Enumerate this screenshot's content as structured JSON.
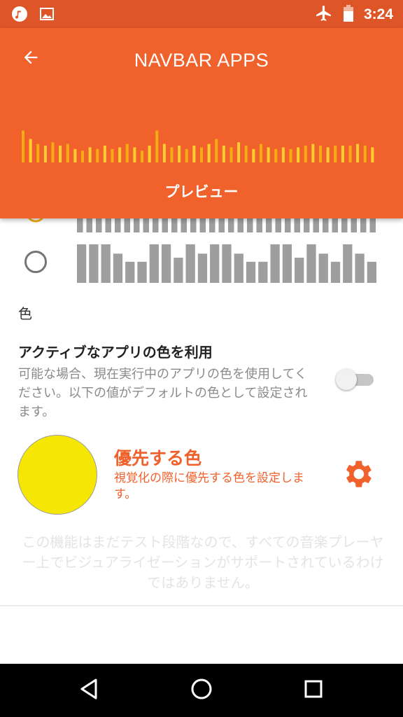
{
  "status_bar": {
    "time": "3:24",
    "left_icons": [
      "music-icon",
      "image-icon"
    ],
    "right_icons": [
      "airplane-icon",
      "battery-icon"
    ]
  },
  "app_bar": {
    "title": "NAVBAR APPS",
    "back_icon": "arrow-back-icon",
    "preview_label": "プレビュー",
    "preview_bar_heights": [
      0.95,
      0.7,
      0.55,
      0.5,
      0.6,
      0.5,
      0.55,
      0.4,
      0.35,
      0.45,
      0.4,
      0.5,
      0.4,
      0.45,
      0.55,
      0.45,
      0.35,
      0.5,
      0.95,
      0.55,
      0.45,
      0.5,
      0.4,
      0.5,
      0.45,
      0.55,
      0.7,
      0.5,
      0.45,
      0.6,
      0.5,
      0.4,
      0.55,
      0.45,
      0.4,
      0.45,
      0.4,
      0.45,
      0.5,
      0.55,
      0.5,
      0.45,
      0.5,
      0.5,
      0.5,
      0.55,
      0.5,
      0.45
    ],
    "colors": {
      "background": "#f0612c",
      "status_bar": "#de5527",
      "bar_primary": "#f5ac12",
      "bar_secondary": "#ffce2e"
    }
  },
  "styles": {
    "partial_option_bar_count": 32,
    "option_bar_heights": [
      0.95,
      0.95,
      0.95,
      0.72,
      0.52,
      0.52,
      0.95,
      0.95,
      0.62,
      0.95,
      0.72,
      0.95,
      0.95,
      0.72,
      0.52,
      0.52,
      0.95,
      0.95,
      0.62,
      0.95,
      0.72,
      0.52,
      0.95,
      0.72,
      0.52
    ],
    "bar_color": "#9e9e9e"
  },
  "color_section": {
    "header": "色",
    "use_app_color": {
      "title": "アクティブなアプリの色を利用",
      "summary": "可能な場合、現在実行中のアプリの色を使用してください。以下の値がデフォルトの色として設定されます。",
      "enabled": false
    },
    "preferred_color": {
      "title": "優先する色",
      "summary": "視覚化の際に優先する色を設定します。",
      "swatch": "#f5e603",
      "accent": "#f0612c",
      "settings_icon": "gear-icon"
    },
    "note": "この機能はまだテスト段階なので、すべての音楽プレーヤー上でビジュアライゼーションがサポートされているわけではありません。"
  },
  "nav_bar": {
    "buttons": [
      "back-triangle-icon",
      "home-circle-icon",
      "recents-square-icon"
    ]
  }
}
